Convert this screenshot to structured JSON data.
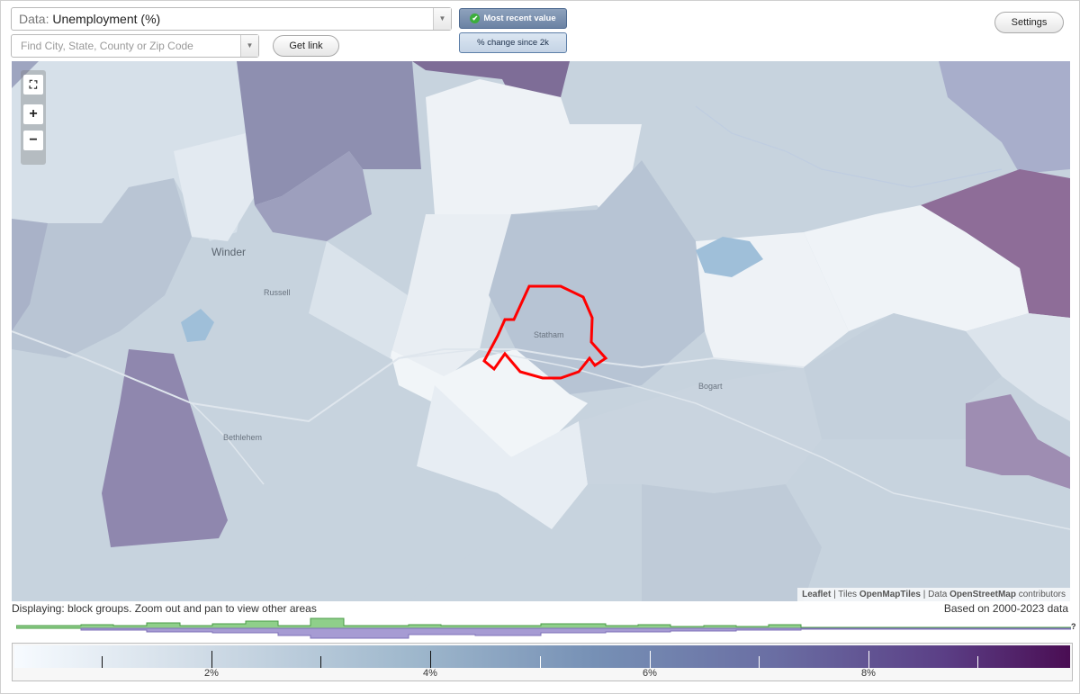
{
  "header": {
    "data_prefix": "Data:",
    "data_value": "Unemployment (%)",
    "search_placeholder": "Find City, State, County or Zip Code",
    "get_link": "Get link",
    "toggle_recent": "Most recent value",
    "toggle_change": "% change since 2k",
    "settings": "Settings"
  },
  "map": {
    "place_labels": [
      "Winder",
      "Russell",
      "Statham",
      "Bogart",
      "Bethlehem"
    ],
    "attribution": {
      "leaflet": "Leaflet",
      "tiles_prefix": "| Tiles",
      "tiles": "OpenMapTiles",
      "data_prefix": "| Data",
      "data": "OpenStreetMap",
      "suffix": "contributors"
    },
    "zoom": {
      "fullscreen": "⛶",
      "in": "+",
      "out": "−"
    }
  },
  "footer": {
    "displaying": "Displaying: block groups. Zoom out and pan to view other areas",
    "based_on": "Based on 2000-2023 data",
    "unknown_mark": "?"
  },
  "legend": {
    "labels": [
      "2%",
      "4%",
      "6%",
      "8%"
    ],
    "colors": [
      "#f7fbff",
      "#cfdbe6",
      "#9eb7cc",
      "#7690b5",
      "#6a6ea3",
      "#5b3f86",
      "#4a0d53"
    ]
  },
  "colors": {
    "highlight_outline": "#ff0000",
    "histogram_green": "#8fcf8a",
    "histogram_purple": "#a69bd3"
  }
}
